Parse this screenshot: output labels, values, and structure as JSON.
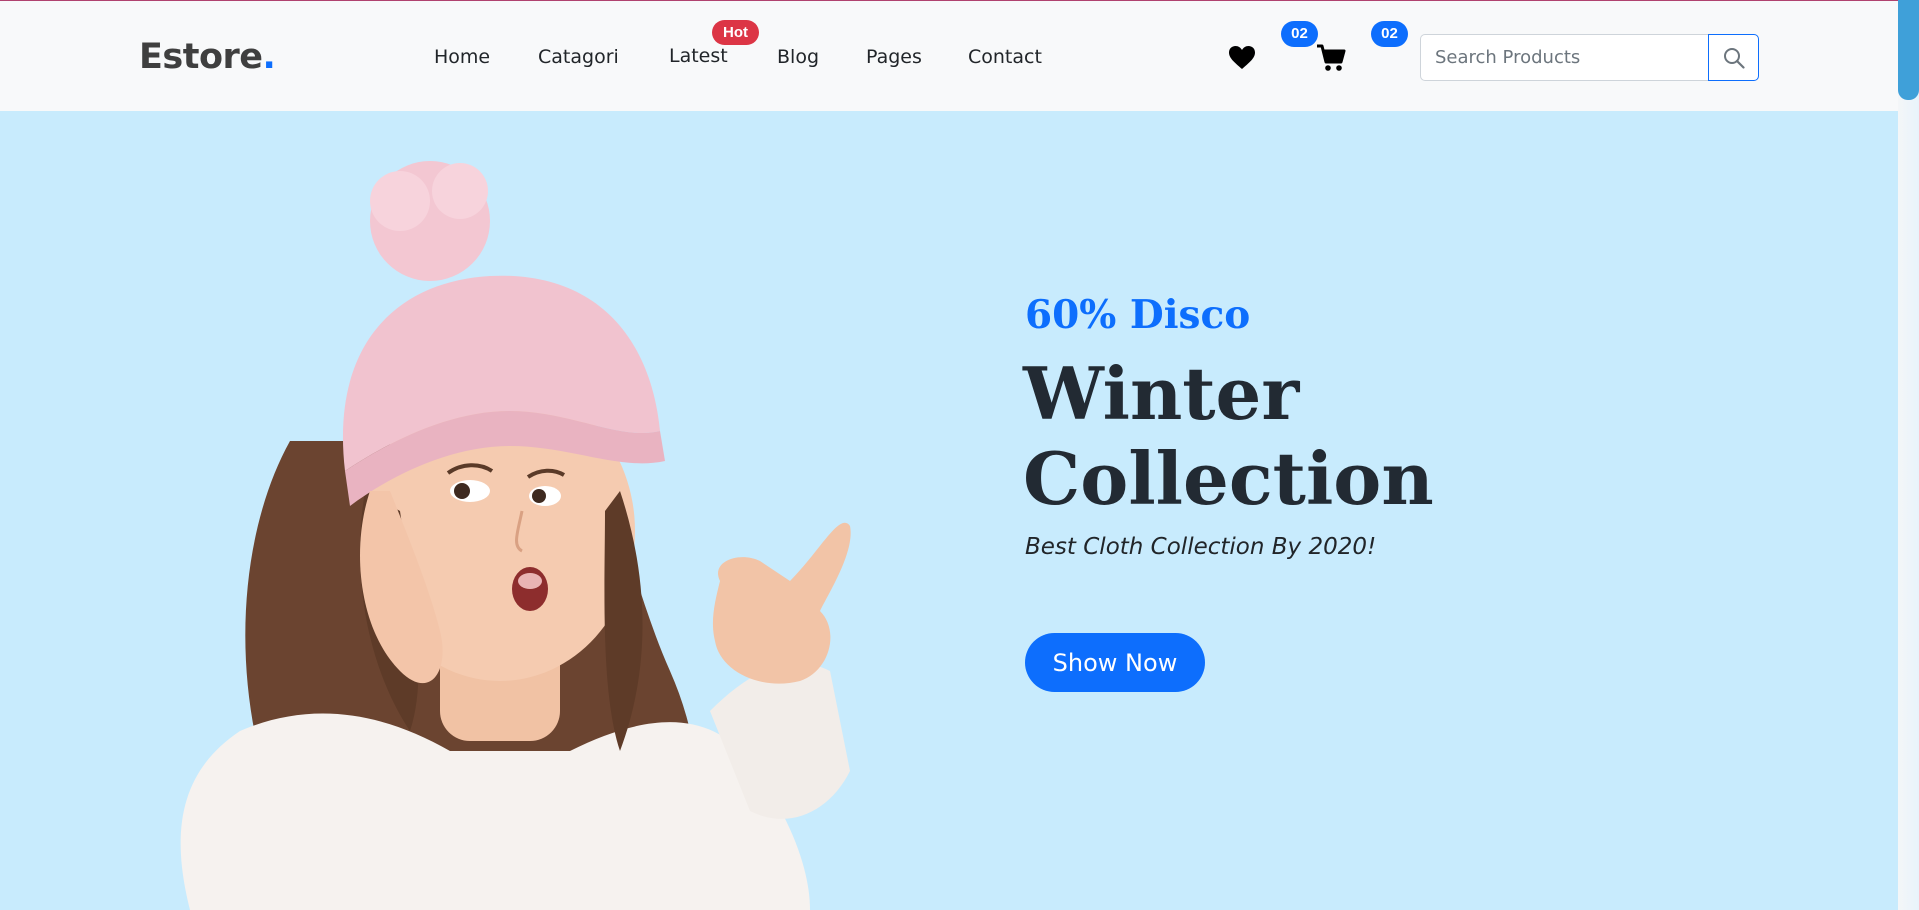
{
  "brand": {
    "name": "Estore",
    "dot": ".",
    "accent": "#0d6efd"
  },
  "nav": {
    "items": [
      {
        "label": "Home"
      },
      {
        "label": "Catagori"
      },
      {
        "label": "Latest",
        "badge": "Hot"
      },
      {
        "label": "Blog"
      },
      {
        "label": "Pages"
      },
      {
        "label": "Contact"
      }
    ]
  },
  "actions": {
    "wishlist": {
      "icon": "heart-icon",
      "count": "02"
    },
    "cart": {
      "icon": "cart-icon",
      "count": "02"
    }
  },
  "search": {
    "placeholder": "Search Products",
    "value": "",
    "button_icon": "search-icon"
  },
  "hero": {
    "discount": "60% Disco",
    "title_line1": "Winter",
    "title_line2": "Collection",
    "subtitle": "Best Cloth Collection By 2020!",
    "cta_label": "Show Now",
    "background": "#c8ebfd",
    "image": "girl-in-pink-beanie-pointing-image"
  }
}
